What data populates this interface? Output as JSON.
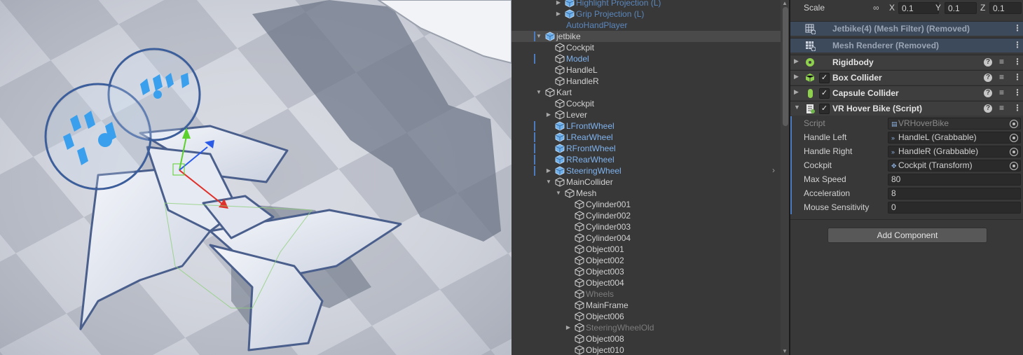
{
  "hierarchy": {
    "items": [
      {
        "label": "Highlight Projection (L)",
        "depth": 3,
        "arrow": "collapsed",
        "icon": "prefab",
        "style": "prefab-dim"
      },
      {
        "label": "Grip Projection (L)",
        "depth": 3,
        "arrow": "collapsed",
        "icon": "prefab",
        "style": "prefab-dim"
      },
      {
        "label": "AutoHandPlayer",
        "depth": 2,
        "arrow": "none",
        "icon": "none",
        "style": "prefab-dim"
      },
      {
        "label": "jetbike",
        "depth": 1,
        "arrow": "expanded",
        "icon": "prefab",
        "style": "normal",
        "selected": true,
        "marked": true
      },
      {
        "label": "Cockpit",
        "depth": 2,
        "arrow": "none",
        "icon": "object",
        "style": "normal"
      },
      {
        "label": "Model",
        "depth": 2,
        "arrow": "none",
        "icon": "object",
        "style": "prefab",
        "marked": true
      },
      {
        "label": "HandleL",
        "depth": 2,
        "arrow": "none",
        "icon": "object",
        "style": "normal"
      },
      {
        "label": "HandleR",
        "depth": 2,
        "arrow": "none",
        "icon": "object",
        "style": "normal"
      },
      {
        "label": "Kart",
        "depth": 1,
        "arrow": "expanded",
        "icon": "object",
        "style": "normal"
      },
      {
        "label": "Cockpit",
        "depth": 2,
        "arrow": "none",
        "icon": "object",
        "style": "normal"
      },
      {
        "label": "Lever",
        "depth": 2,
        "arrow": "collapsed",
        "icon": "object",
        "style": "normal"
      },
      {
        "label": "LFrontWheel",
        "depth": 2,
        "arrow": "none",
        "icon": "prefab",
        "style": "prefab",
        "marked": true
      },
      {
        "label": "LRearWheel",
        "depth": 2,
        "arrow": "none",
        "icon": "prefab",
        "style": "prefab",
        "marked": true
      },
      {
        "label": "RFrontWheel",
        "depth": 2,
        "arrow": "none",
        "icon": "prefab",
        "style": "prefab",
        "marked": true
      },
      {
        "label": "RRearWheel",
        "depth": 2,
        "arrow": "none",
        "icon": "prefab",
        "style": "prefab",
        "marked": true
      },
      {
        "label": "SteeringWheel",
        "depth": 2,
        "arrow": "collapsed",
        "icon": "prefab",
        "style": "prefab",
        "marked": true
      },
      {
        "label": "MainCollider",
        "depth": 2,
        "arrow": "expanded",
        "icon": "object",
        "style": "normal"
      },
      {
        "label": "Mesh",
        "depth": 3,
        "arrow": "expanded",
        "icon": "object",
        "style": "normal"
      },
      {
        "label": "Cylinder001",
        "depth": 4,
        "arrow": "none",
        "icon": "object",
        "style": "normal"
      },
      {
        "label": "Cylinder002",
        "depth": 4,
        "arrow": "none",
        "icon": "object",
        "style": "normal"
      },
      {
        "label": "Cylinder003",
        "depth": 4,
        "arrow": "none",
        "icon": "object",
        "style": "normal"
      },
      {
        "label": "Cylinder004",
        "depth": 4,
        "arrow": "none",
        "icon": "object",
        "style": "normal"
      },
      {
        "label": "Object001",
        "depth": 4,
        "arrow": "none",
        "icon": "object",
        "style": "normal"
      },
      {
        "label": "Object002",
        "depth": 4,
        "arrow": "none",
        "icon": "object",
        "style": "normal"
      },
      {
        "label": "Object003",
        "depth": 4,
        "arrow": "none",
        "icon": "object",
        "style": "normal"
      },
      {
        "label": "Object004",
        "depth": 4,
        "arrow": "none",
        "icon": "object",
        "style": "normal"
      },
      {
        "label": "Wheels",
        "depth": 4,
        "arrow": "none",
        "icon": "object",
        "style": "disabled"
      },
      {
        "label": "MainFrame",
        "depth": 4,
        "arrow": "none",
        "icon": "object",
        "style": "normal"
      },
      {
        "label": "Object006",
        "depth": 4,
        "arrow": "none",
        "icon": "object",
        "style": "normal"
      },
      {
        "label": "SteeringWheelOld",
        "depth": 4,
        "arrow": "collapsed",
        "icon": "object",
        "style": "disabled"
      },
      {
        "label": "Object008",
        "depth": 4,
        "arrow": "none",
        "icon": "object",
        "style": "normal"
      },
      {
        "label": "Object010",
        "depth": 4,
        "arrow": "none",
        "icon": "object",
        "style": "normal"
      }
    ]
  },
  "inspector": {
    "scale": {
      "label": "Scale",
      "x_label": "X",
      "x": "0.1",
      "y_label": "Y",
      "y": "0.1",
      "z_label": "Z",
      "z": "0.1"
    },
    "components": [
      {
        "title": "Jetbike(4) (Mesh Filter) (Removed)",
        "removed": true,
        "icon": "mesh-filter-icon",
        "checkbox": false,
        "foldout": false
      },
      {
        "title": "Mesh Renderer (Removed)",
        "removed": true,
        "icon": "mesh-renderer-icon",
        "checkbox": false,
        "foldout": false
      },
      {
        "title": "Rigidbody",
        "removed": false,
        "icon": "rigidbody-icon",
        "checkbox": false,
        "foldout": "collapsed"
      },
      {
        "title": "Box Collider",
        "removed": false,
        "icon": "box-collider-icon",
        "checkbox": true,
        "foldout": "collapsed"
      },
      {
        "title": "Capsule Collider",
        "removed": false,
        "icon": "capsule-collider-icon",
        "checkbox": true,
        "foldout": "collapsed"
      },
      {
        "title": "VR Hover Bike (Script)",
        "removed": false,
        "icon": "script-icon",
        "checkbox": true,
        "foldout": "expanded"
      }
    ],
    "properties": [
      {
        "label": "Script",
        "value": "VRHoverBike",
        "dim": true,
        "type": "script"
      },
      {
        "label": "Handle Left",
        "value": "HandleL (Grabbable)",
        "type": "object"
      },
      {
        "label": "Handle Right",
        "value": "HandleR (Grabbable)",
        "type": "object"
      },
      {
        "label": "Cockpit",
        "value": "Cockpit (Transform)",
        "type": "transform"
      },
      {
        "label": "Max Speed",
        "value": "80",
        "type": "number"
      },
      {
        "label": "Acceleration",
        "value": "8",
        "type": "number"
      },
      {
        "label": "Mouse Sensitivity",
        "value": "0",
        "type": "number"
      }
    ],
    "add_component_label": "Add Component"
  },
  "colors": {
    "accent": "#4c7bc0",
    "prefab_text": "#7fb3ee",
    "panel_bg": "#383838",
    "x_axis": "#e0302a",
    "y_axis": "#5cd02c",
    "z_axis": "#2a5ae8"
  }
}
